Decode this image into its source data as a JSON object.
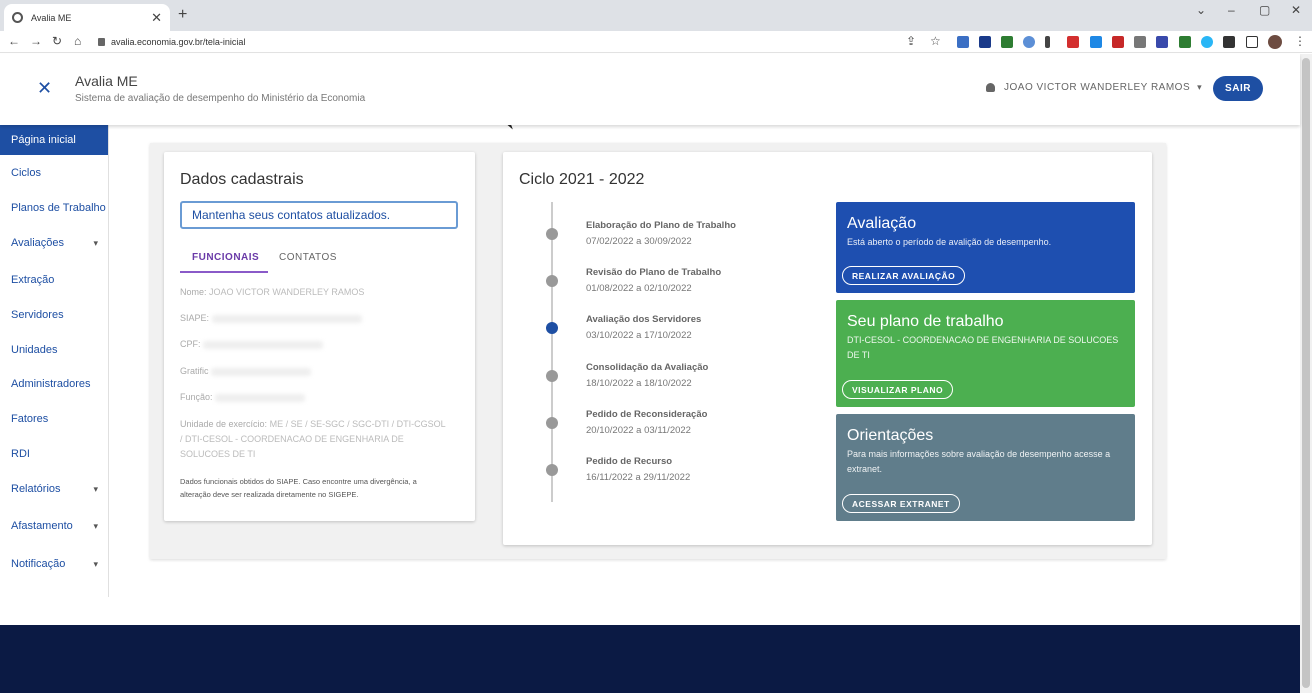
{
  "browser": {
    "tab_title": "Avalia ME",
    "url": "avalia.economia.gov.br/tela-inicial"
  },
  "header": {
    "app_title": "Avalia ME",
    "app_subtitle": "Sistema de avaliação de desempenho do Ministério da Economia",
    "user_name": "JOAO VICTOR WANDERLEY RAMOS",
    "logout_label": "SAIR"
  },
  "sidebar": {
    "items": [
      {
        "label": "Página inicial"
      },
      {
        "label": "Ciclos"
      },
      {
        "label": "Planos de Trabalho"
      },
      {
        "label": "Avaliações"
      },
      {
        "label": "Extração"
      },
      {
        "label": "Servidores"
      },
      {
        "label": "Unidades"
      },
      {
        "label": "Administradores"
      },
      {
        "label": "Fatores"
      },
      {
        "label": "RDI"
      },
      {
        "label": "Relatórios"
      },
      {
        "label": "Afastamento"
      },
      {
        "label": "Notificação"
      }
    ]
  },
  "dados": {
    "title": "Dados cadastrais",
    "contact_notice": "Mantenha seus contatos atualizados.",
    "tab_funcionais": "FUNCIONAIS",
    "tab_contatos": "CONTATOS",
    "nome_label": "Nome:",
    "nome_value": "JOAO VICTOR WANDERLEY RAMOS",
    "siape_label": "SIAPE:",
    "cpf_label": "CPF:",
    "gratificacao_label": "Gratific",
    "funcao_label": "Função:",
    "unidade_label": "Unidade de exercício:",
    "unidade_value": "ME / SE / SE-SGC / SGC-DTI / DTI-CGSOL / DTI-CESOL - COORDENACAO DE ENGENHARIA DE SOLUCOES DE TI",
    "footnote": "Dados funcionais obtidos do SIAPE. Caso encontre uma divergência, a alteração deve ser realizada diretamente no SIGEPE."
  },
  "ciclo": {
    "title": "Ciclo 2021 - 2022",
    "steps": [
      {
        "title": "Elaboração do Plano de Trabalho",
        "dates": "07/02/2022 a 30/09/2022"
      },
      {
        "title": "Revisão do Plano de Trabalho",
        "dates": "01/08/2022 a 02/10/2022"
      },
      {
        "title": "Avaliação dos Servidores",
        "dates": "03/10/2022 a 17/10/2022"
      },
      {
        "title": "Consolidação da Avaliação",
        "dates": "18/10/2022 a 18/10/2022"
      },
      {
        "title": "Pedido de Reconsideração",
        "dates": "20/10/2022 a 03/11/2022"
      },
      {
        "title": "Pedido de Recurso",
        "dates": "16/11/2022 a 29/11/2022"
      }
    ],
    "current_step": 2
  },
  "panels": {
    "avaliacao": {
      "title": "Avaliação",
      "desc": "Está aberto o período de avalição de desempenho.",
      "button": "REALIZAR AVALIAÇÃO",
      "color": "#1e4fb0"
    },
    "plano": {
      "title": "Seu plano de trabalho",
      "desc": "DTI-CESOL - COORDENACAO DE ENGENHARIA DE SOLUCOES DE TI",
      "button": "VISUALIZAR PLANO",
      "color": "#4caf50"
    },
    "orientacoes": {
      "title": "Orientações",
      "desc": "Para mais informações sobre avaliação de desempenho acesse a extranet.",
      "button": "ACESSAR EXTRANET",
      "color": "#607d8b"
    }
  }
}
